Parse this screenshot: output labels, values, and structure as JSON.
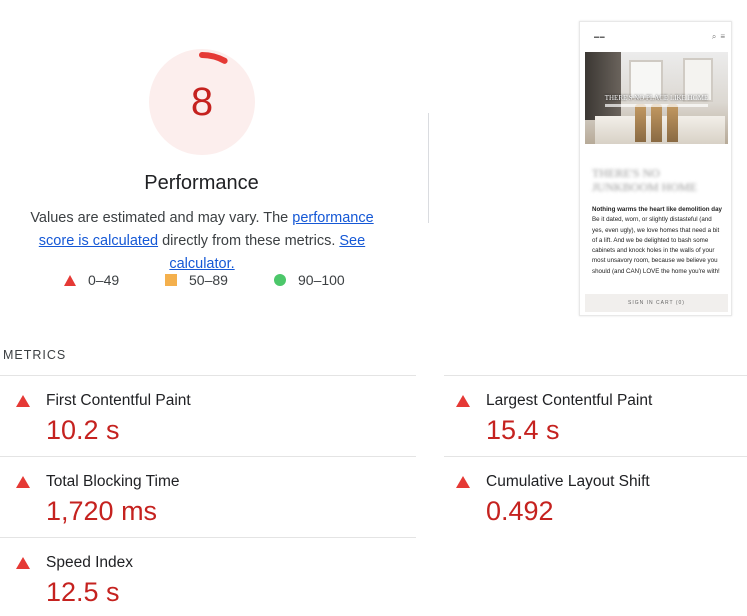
{
  "score": {
    "value": "8",
    "numeric": 8,
    "color": "#c5221f",
    "ring_color": "#e53935",
    "bg_color": "#fceeed"
  },
  "performance": {
    "title": "Performance",
    "desc_part1": "Values are estimated and may vary. The ",
    "link1": "performance score is calculated",
    "desc_part2": " directly from these metrics. ",
    "link2": "See calculator."
  },
  "legend": [
    {
      "label": "0–49",
      "shape": "triangle",
      "color": "#e53935"
    },
    {
      "label": "50–89",
      "shape": "square",
      "color": "#f4b04d"
    },
    {
      "label": "90–100",
      "shape": "circle",
      "color": "#4cc76a"
    }
  ],
  "thumbnail": {
    "hero_caption": "THERE'S NO PLACE LIKE HOME",
    "blurred_heading": "THERE'S NO JUNKBOOM HOME",
    "body_bold": "Nothing warms the heart like demolition day",
    "body_rest": " Be it dated, worn, or slightly distasteful (and yes, even ugly), we love homes that need a bit of a lift. And we be delighted to bash some cabinets and knock holes in the walls of your most unsavory room, because we believe you should (and CAN) LOVE the home you're with!",
    "footer": "SIGN IN   CART (0)"
  },
  "metrics": {
    "title": "METRICS",
    "items": [
      {
        "label": "First Contentful Paint",
        "value": "10.2 s"
      },
      {
        "label": "Largest Contentful Paint",
        "value": "15.4 s"
      },
      {
        "label": "Total Blocking Time",
        "value": "1,720 ms"
      },
      {
        "label": "Cumulative Layout Shift",
        "value": "0.492"
      },
      {
        "label": "Speed Index",
        "value": "12.5 s"
      }
    ]
  }
}
